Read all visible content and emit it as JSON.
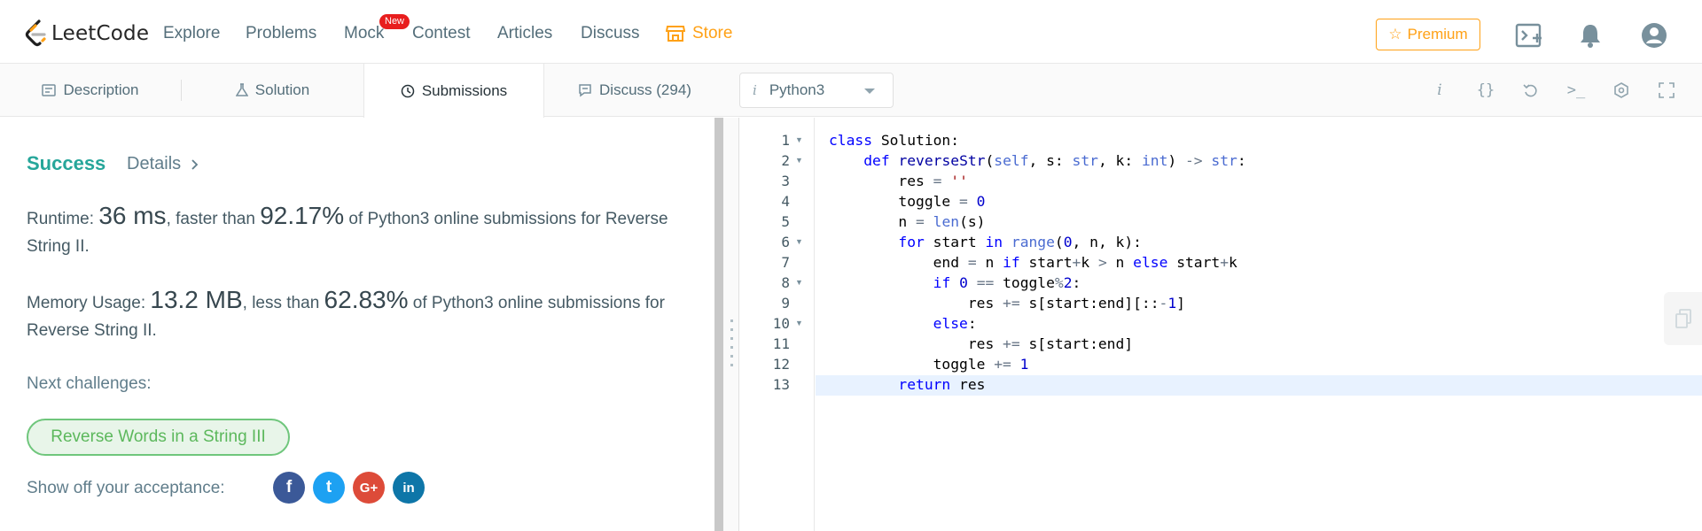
{
  "navbar": {
    "logo_text": "LeetCode",
    "items": [
      "Explore",
      "Problems",
      "Mock",
      "Contest",
      "Articles",
      "Discuss"
    ],
    "new_badge": "New",
    "store_label": "Store",
    "premium_label": "Premium",
    "colors": {
      "accent": "#ffa116",
      "badge": "#e81e1e"
    }
  },
  "tabs": {
    "description": "Description",
    "solution": "Solution",
    "submissions": "Submissions",
    "discuss": "Discuss (294)",
    "language": "Python3"
  },
  "result": {
    "status": "Success",
    "details_label": "Details",
    "runtime": {
      "label": "Runtime: ",
      "value": "36 ms",
      "mid": ", faster than ",
      "percent": "92.17%",
      "tail": " of Python3 online submissions for Reverse String II."
    },
    "memory": {
      "label": "Memory Usage: ",
      "value": "13.2 MB",
      "mid": ", less than ",
      "percent": "62.83%",
      "tail": " of Python3 online submissions for Reverse String II."
    },
    "next_label": "Next challenges:",
    "next_challenge": "Reverse Words in a String III",
    "share_label": "Show off your acceptance:",
    "social": [
      {
        "name": "facebook",
        "glyph": "f",
        "color": "#3b5998"
      },
      {
        "name": "twitter",
        "glyph": "t",
        "color": "#1da1f2"
      },
      {
        "name": "google-plus",
        "glyph": "G+",
        "color": "#dd4b39"
      },
      {
        "name": "linkedin",
        "glyph": "in",
        "color": "#0e76a8"
      }
    ]
  },
  "editor": {
    "line_numbers": [
      "1",
      "2",
      "3",
      "4",
      "5",
      "6",
      "7",
      "8",
      "9",
      "10",
      "11",
      "12",
      "13"
    ],
    "fold_lines": [
      1,
      2,
      6,
      8,
      10
    ],
    "active_line": 13,
    "code": [
      "class Solution:",
      "    def reverseStr(self, s: str, k: int) -> str:",
      "        res = ''",
      "        toggle = 0",
      "        n = len(s)",
      "        for start in range(0, n, k):",
      "            end = n if start+k > n else start+k",
      "            if 0 == toggle%2:",
      "                res += s[start:end][::-1]",
      "            else:",
      "                res += s[start:end]",
      "            toggle += 1",
      "        return res"
    ]
  }
}
